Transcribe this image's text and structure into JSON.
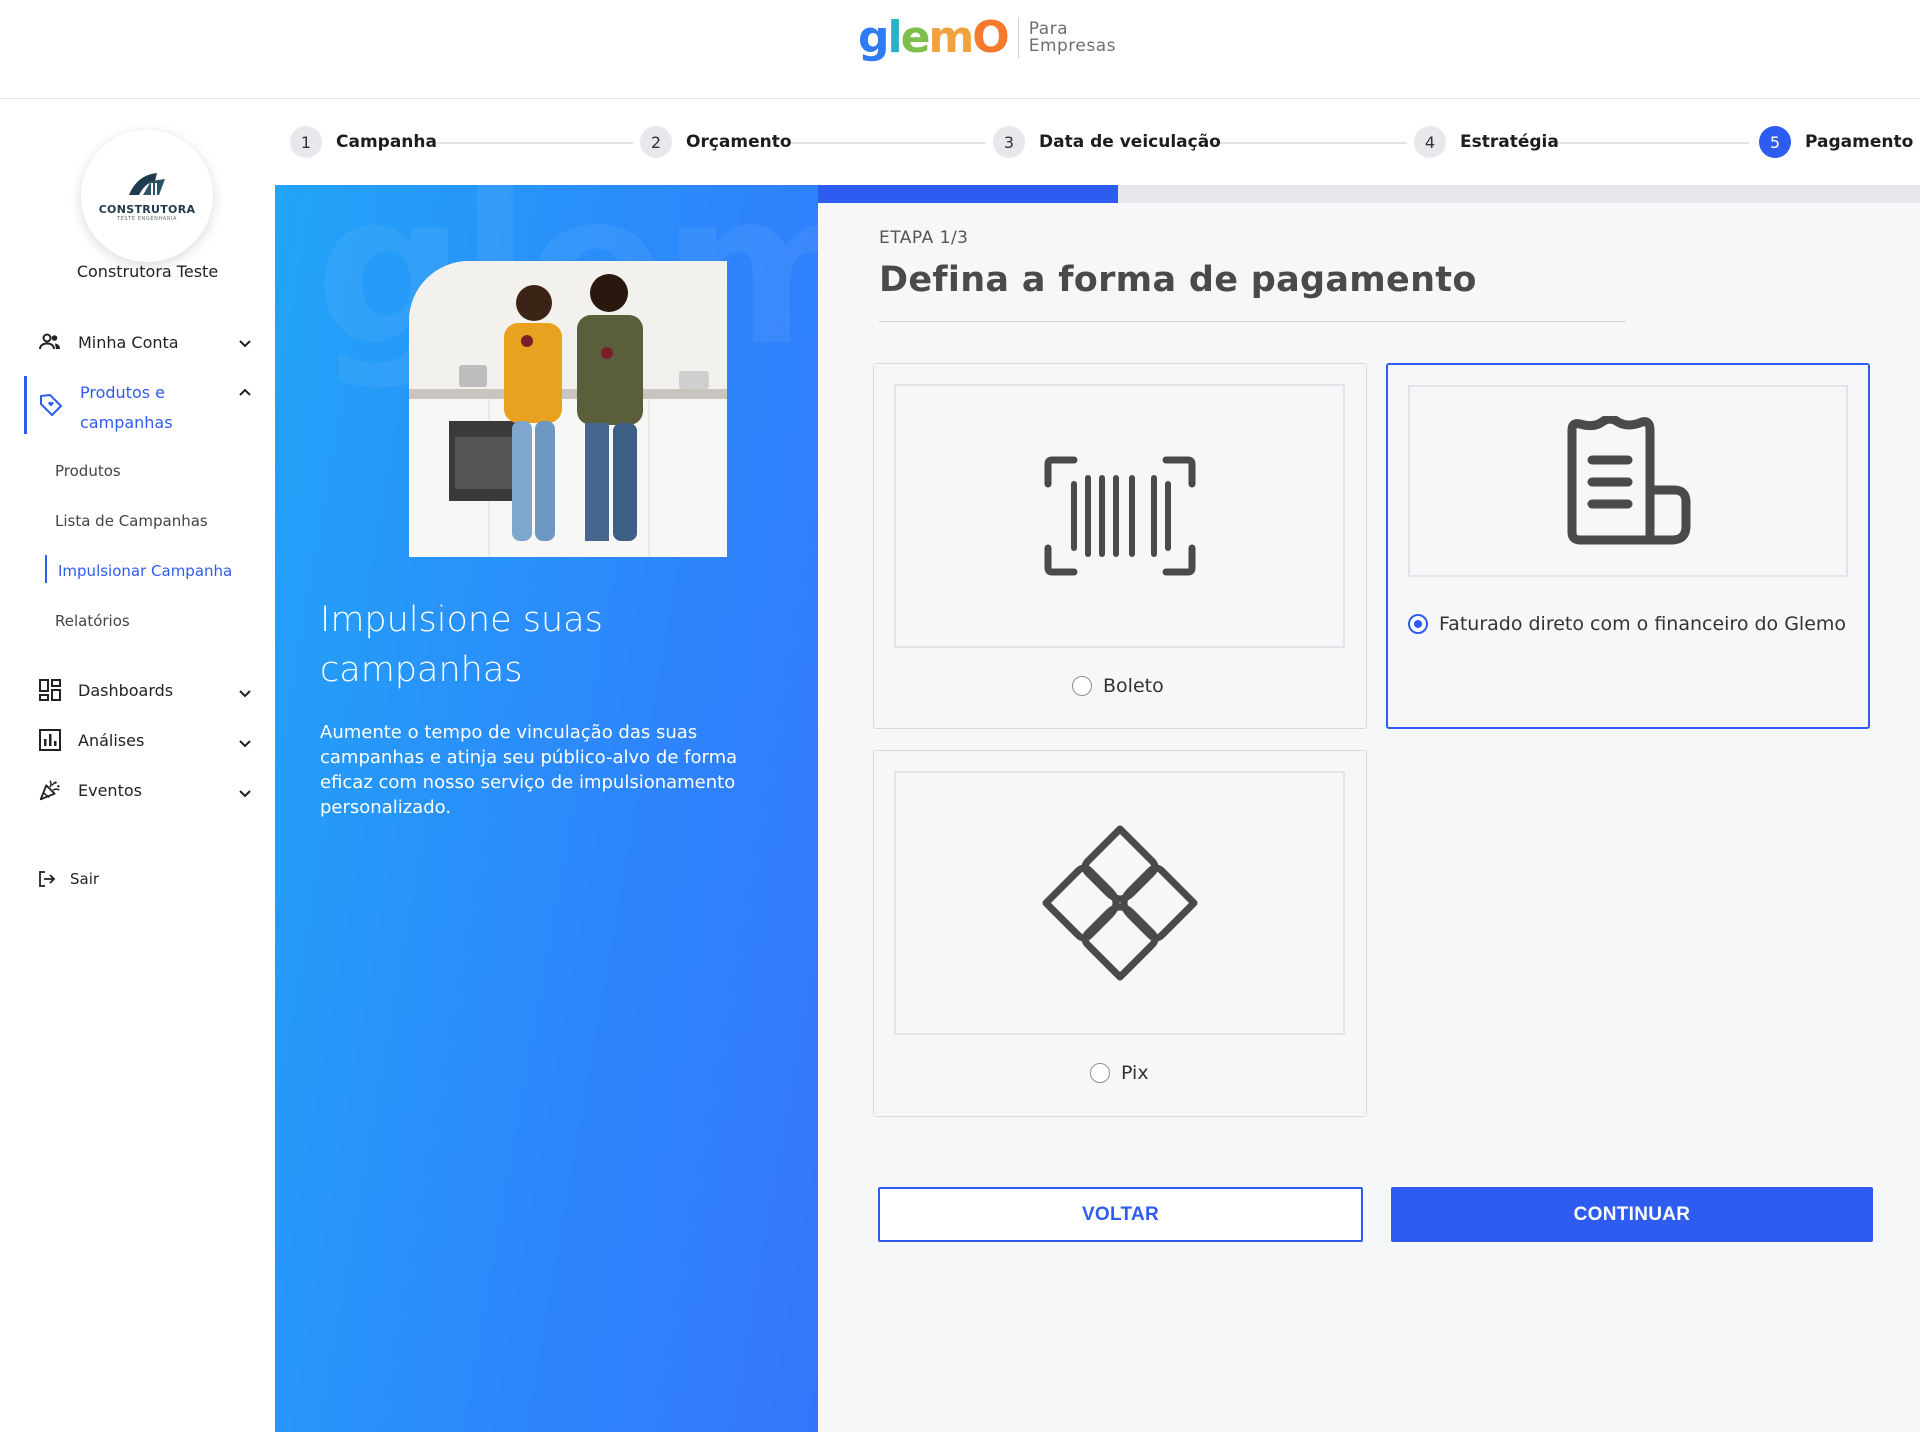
{
  "header": {
    "logo_text": "glemO",
    "logo_sub_line1": "Para",
    "logo_sub_line2": "Empresas"
  },
  "sidebar": {
    "company_logo_text": "CONSTRUTORA",
    "company_logo_tag": "TESTE ENGENHARIA",
    "company_name": "Construtora Teste",
    "items": [
      {
        "label": "Minha Conta",
        "icon": "users-icon",
        "expanded": false
      },
      {
        "label": "Produtos e campanhas",
        "icon": "tag-icon",
        "expanded": true
      },
      {
        "label": "Dashboards",
        "icon": "dashboard-icon",
        "expanded": false
      },
      {
        "label": "Análises",
        "icon": "chart-icon",
        "expanded": false
      },
      {
        "label": "Eventos",
        "icon": "party-icon",
        "expanded": false
      }
    ],
    "sub_items": [
      "Produtos",
      "Lista de Campanhas",
      "Impulsionar Campanha",
      "Relatórios"
    ],
    "logout_label": "Sair"
  },
  "stepper": {
    "steps": [
      {
        "num": "1",
        "label": "Campanha"
      },
      {
        "num": "2",
        "label": "Orçamento"
      },
      {
        "num": "3",
        "label": "Data de veiculação"
      },
      {
        "num": "4",
        "label": "Estratégia"
      },
      {
        "num": "5",
        "label": "Pagamento"
      }
    ],
    "active_step": 5
  },
  "promo": {
    "watermark": "glemO",
    "title": "Impulsione suas campanhas",
    "text": "Aumente o tempo de vinculação das suas campanhas e atinja seu público-alvo de forma eficaz com nosso serviço de impulsionamento personalizado."
  },
  "main": {
    "progress": 0.272,
    "etapa": "ETAPA 1/3",
    "title": "Defina a forma de pagamento",
    "options": [
      {
        "label": "Boleto",
        "icon": "barcode-icon",
        "selected": false
      },
      {
        "label": "Faturado direto com o financeiro do Glemo",
        "icon": "invoice-icon",
        "selected": true
      },
      {
        "label": "Pix",
        "icon": "pix-icon",
        "selected": false
      }
    ],
    "back_label": "VOLTAR",
    "continue_label": "CONTINUAR"
  },
  "colors": {
    "accent": "#2f5cf0",
    "promo_start": "#22a4f7",
    "promo_end": "#3476fb"
  }
}
